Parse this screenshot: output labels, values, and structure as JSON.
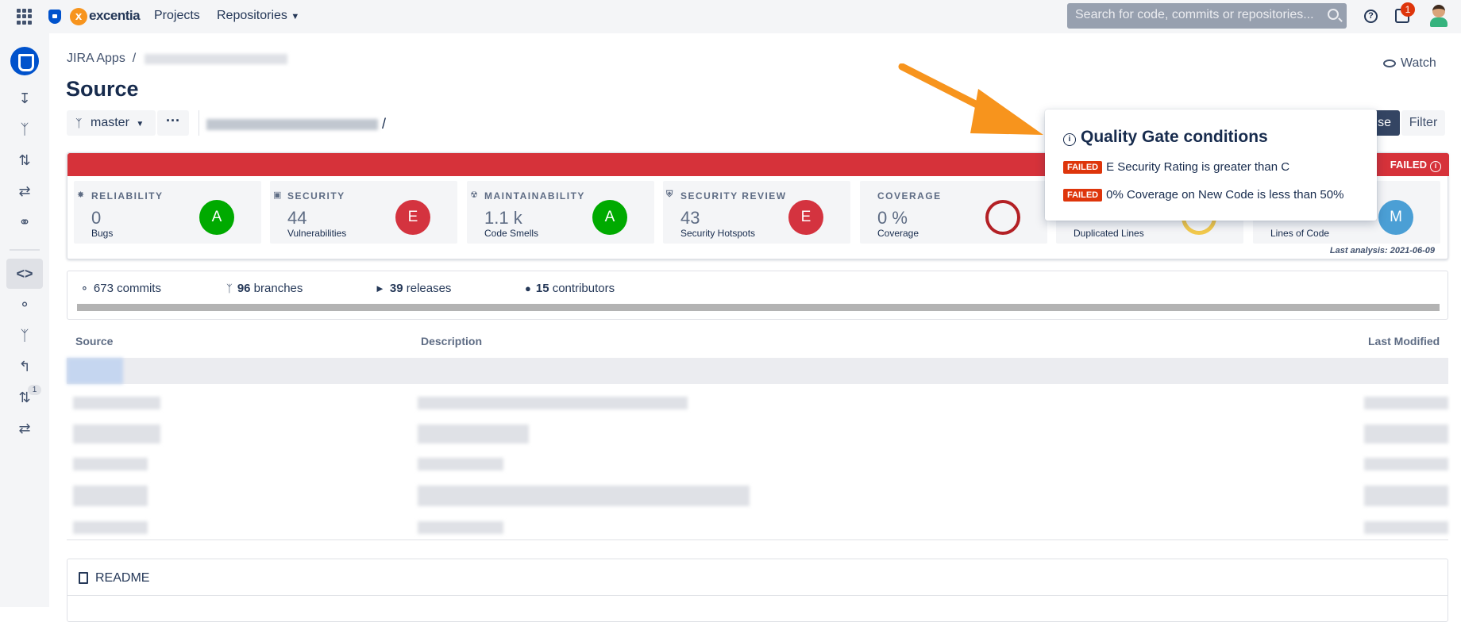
{
  "topbar": {
    "brand": "excentia",
    "nav": [
      "Projects",
      "Repositories"
    ],
    "search_placeholder": "Search for code, commits or repositories...",
    "notification_count": "1"
  },
  "sidebar": {
    "badge": "1"
  },
  "header": {
    "breadcrumb_root": "JIRA Apps",
    "breadcrumb_sep": "/",
    "title": "Source",
    "watch": "Watch"
  },
  "toolbar": {
    "branch": "master",
    "more": "···",
    "path_sep": "/",
    "browse_label": "se",
    "filter_label": "Filter"
  },
  "quality_gate": {
    "status": "FAILED",
    "last_analysis": "Last analysis: 2021-06-09",
    "metrics": [
      {
        "label": "RELIABILITY",
        "value": "0",
        "sub": "Bugs",
        "grade": "A",
        "grade_color": "#00aa00"
      },
      {
        "label": "SECURITY",
        "value": "44",
        "sub": "Vulnerabilities",
        "grade": "E",
        "grade_color": "#d4333f"
      },
      {
        "label": "MAINTAINABILITY",
        "value": "1.1 k",
        "sub": "Code Smells",
        "grade": "A",
        "grade_color": "#00aa00"
      },
      {
        "label": "SECURITY REVIEW",
        "value": "43",
        "sub": "Security Hotspots",
        "grade": "E",
        "grade_color": "#d4333f"
      },
      {
        "label": "COVERAGE",
        "value": "0 %",
        "sub": "Coverage"
      },
      {
        "label": "",
        "value": "",
        "sub": "Duplicated Lines"
      },
      {
        "label": "",
        "value": "",
        "sub": "Lines of Code",
        "grade": "M",
        "grade_color": "#4b9fd5"
      }
    ]
  },
  "popup": {
    "title": "Quality Gate conditions",
    "conditions": [
      {
        "status": "FAILED",
        "text": "E Security Rating is greater than C"
      },
      {
        "status": "FAILED",
        "text": "0% Coverage on New Code is less than 50%"
      }
    ]
  },
  "stats": {
    "commits_count": "673",
    "commits_label": "commits",
    "branches_count": "96",
    "branches_label": "branches",
    "releases_count": "39",
    "releases_label": "releases",
    "contributors_count": "15",
    "contributors_label": "contributors"
  },
  "table": {
    "headers": [
      "Source",
      "Description",
      "Last Modified"
    ]
  },
  "readme": {
    "label": "README"
  },
  "colors": {
    "failed_red": "#d6323a",
    "annotation_orange": "#f7941d",
    "primary_blue": "#0052cc"
  }
}
